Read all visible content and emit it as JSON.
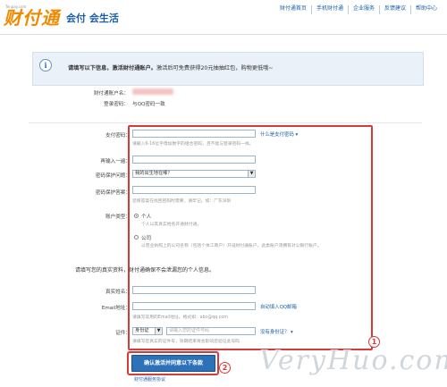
{
  "header": {
    "logo_text": "财付通",
    "logo_small": "Tenpay.com",
    "slogan": "会付 会生活",
    "nav": [
      "财付通首页",
      "手机财付通",
      "企业服务",
      "反馈建议",
      "帮助中心"
    ]
  },
  "info": {
    "icon": "i",
    "title_bold": "请填写以下信息，激活财付通账户。",
    "title_rest": "激活后可免费获得20元抽抽红包，购物更低哦~",
    "account_label": "财付通账户名：",
    "password_label": "登录密码：",
    "password_value": "与QQ密码一致"
  },
  "form": {
    "pay_password_label": "支付密码：",
    "pay_password_link": "什么是支付密码 ▾",
    "pay_password_hint": "请输入6-16位字母加数字的组合密码，且不能与登录密码一样。",
    "confirm_label": "再输入一遍：",
    "question_label": "密码保护问题：",
    "question_value": "我的出生地在哪？",
    "answer_label": "密码保护答案：",
    "answer_hint": "您保答案在找回密码时需要，请牢记。如：广东深圳",
    "account_type_label": "账户类型：",
    "type_personal": "个人",
    "type_personal_hint": "个人以其真实姓名开通财付通。",
    "type_company": "公司",
    "type_company_hint": "以营业执照上的公司名称（包括个体工商户）开设财付通账户，此类账户须拥有对公银行账户。",
    "realinfo_notice": "请填写您的真实资料，财付通确保不会泄漏您的个人信息。",
    "realname_label": "真实姓名：",
    "email_label": "Email地址：",
    "email_link": "自动填入QQ邮箱",
    "email_hint": "请填写常用的Email地址，格式如：abc@qq.com",
    "id_label": "证件：",
    "id_type_value": "身份证",
    "id_placeholder": "请输入您的证件号码",
    "id_link": "没有身份证？ ▾",
    "id_hint": "请填写您真实的证件号，效期结束将会影响您验证此号码"
  },
  "annotations": {
    "one": "1",
    "two": "2"
  },
  "submit_label": "确认激活并同意以下条款",
  "agreement_link": "财付通服务协议",
  "watermark": "VeryHuo.com"
}
